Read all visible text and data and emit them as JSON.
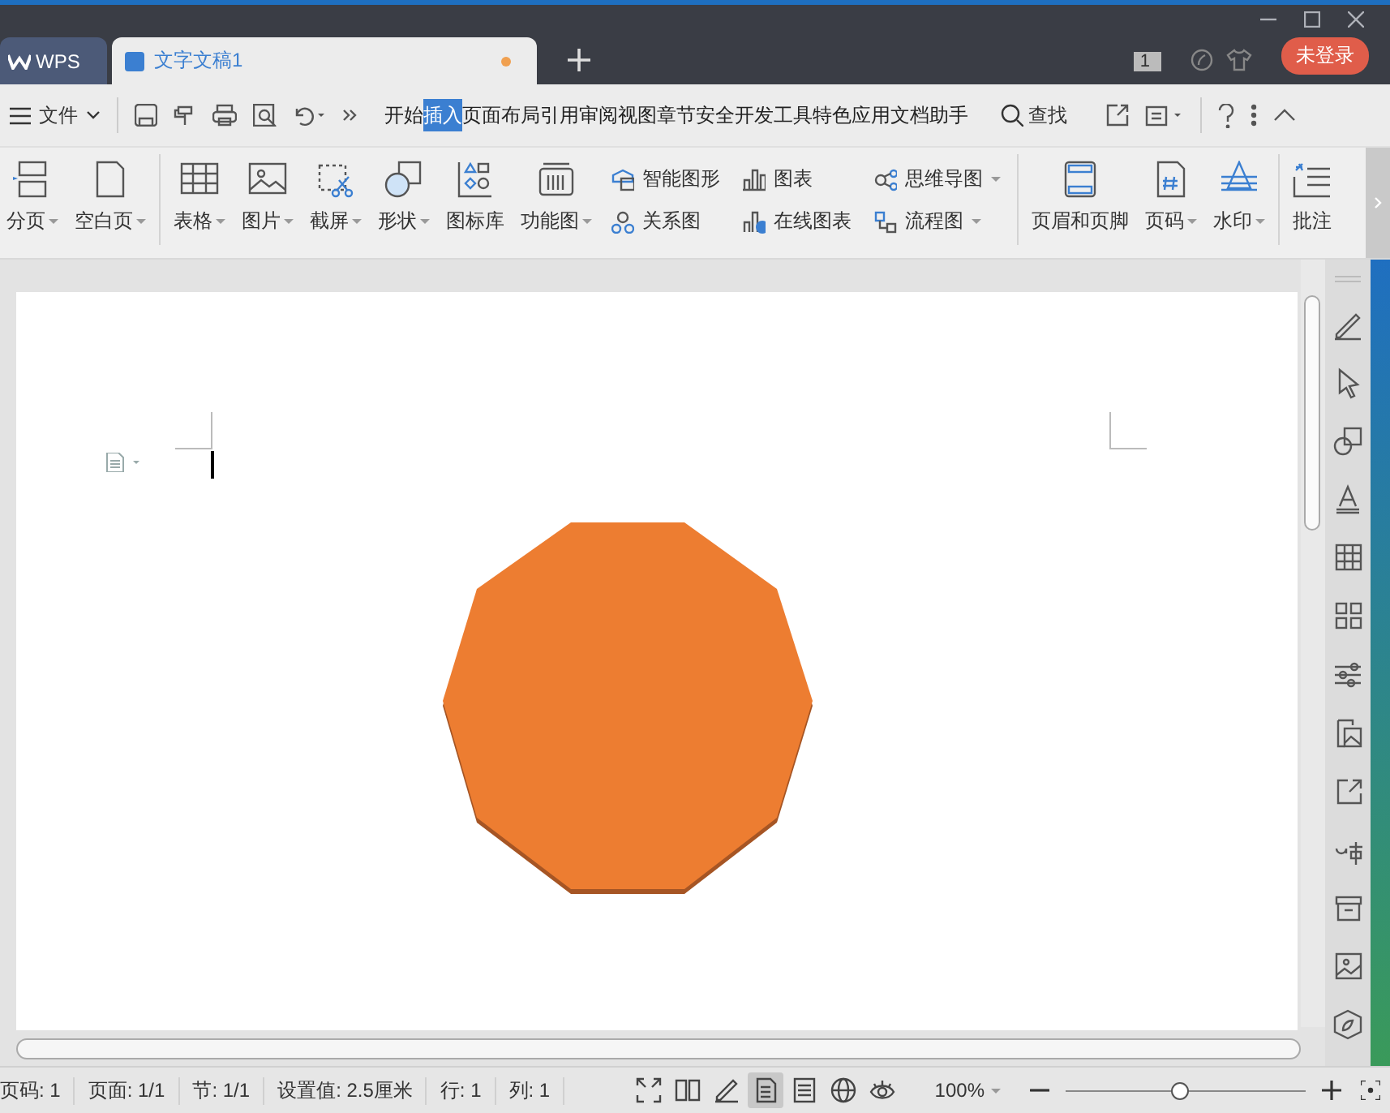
{
  "title_bar": {
    "tabs": [
      {
        "kind": "home",
        "label": "WPS",
        "selected": false
      },
      {
        "kind": "doc",
        "label": "文字文稿1",
        "selected": true,
        "unsaved": true
      }
    ],
    "badge": "1",
    "login": "未登录"
  },
  "menu_bar": {
    "file": "文件",
    "tabs": [
      {
        "label": "开始",
        "selected": false
      },
      {
        "label": "插入",
        "selected": true
      },
      {
        "label": "页面布局",
        "selected": false
      },
      {
        "label": "引用",
        "selected": false
      },
      {
        "label": "审阅",
        "selected": false
      },
      {
        "label": "视图",
        "selected": false
      },
      {
        "label": "章节",
        "selected": false
      },
      {
        "label": "安全",
        "selected": false
      },
      {
        "label": "开发工具",
        "selected": false
      },
      {
        "label": "特色应用",
        "selected": false
      },
      {
        "label": "文档助手",
        "selected": false
      }
    ],
    "search": "查找"
  },
  "ribbon": {
    "groups": [
      {
        "items": [
          {
            "kind": "big",
            "label": "分页",
            "dropdown": true
          },
          {
            "kind": "big",
            "label": "空白页",
            "dropdown": true
          }
        ]
      },
      {
        "items": [
          {
            "kind": "big",
            "label": "表格",
            "dropdown": true
          },
          {
            "kind": "big",
            "label": "图片",
            "dropdown": true
          },
          {
            "kind": "big",
            "label": "截屏",
            "dropdown": true
          },
          {
            "kind": "big",
            "label": "形状",
            "dropdown": true
          },
          {
            "kind": "big",
            "label": "图标库",
            "dropdown": false
          },
          {
            "kind": "big",
            "label": "功能图",
            "dropdown": true
          },
          {
            "kind": "stack",
            "rows": [
              {
                "label": "智能图形",
                "dropdown": false
              },
              {
                "label": "关系图",
                "dropdown": false
              }
            ]
          },
          {
            "kind": "stack",
            "rows": [
              {
                "label": "图表",
                "dropdown": false
              },
              {
                "label": "在线图表",
                "dropdown": false
              }
            ]
          },
          {
            "kind": "stack",
            "rows": [
              {
                "label": "思维导图",
                "dropdown": true
              },
              {
                "label": "流程图",
                "dropdown": true
              }
            ]
          }
        ]
      },
      {
        "items": [
          {
            "kind": "big",
            "label": "页眉和页脚",
            "dropdown": false
          },
          {
            "kind": "big",
            "label": "页码",
            "dropdown": true
          },
          {
            "kind": "big",
            "label": "水印",
            "dropdown": true
          }
        ]
      },
      {
        "items": [
          {
            "kind": "big",
            "label": "批注",
            "dropdown": false
          }
        ]
      }
    ]
  },
  "status_bar": {
    "fields": [
      "页码: 1",
      "页面: 1/1",
      "节: 1/1",
      "设置值: 2.5厘米",
      "行: 1",
      "列: 1"
    ],
    "view_modes": [
      {
        "selected": false
      },
      {
        "selected": false
      },
      {
        "selected": false
      },
      {
        "selected": true
      },
      {
        "selected": false
      },
      {
        "selected": false
      },
      {
        "selected": false
      }
    ],
    "zoom": "100%",
    "zoom_slider": {
      "level": 0.48
    }
  }
}
